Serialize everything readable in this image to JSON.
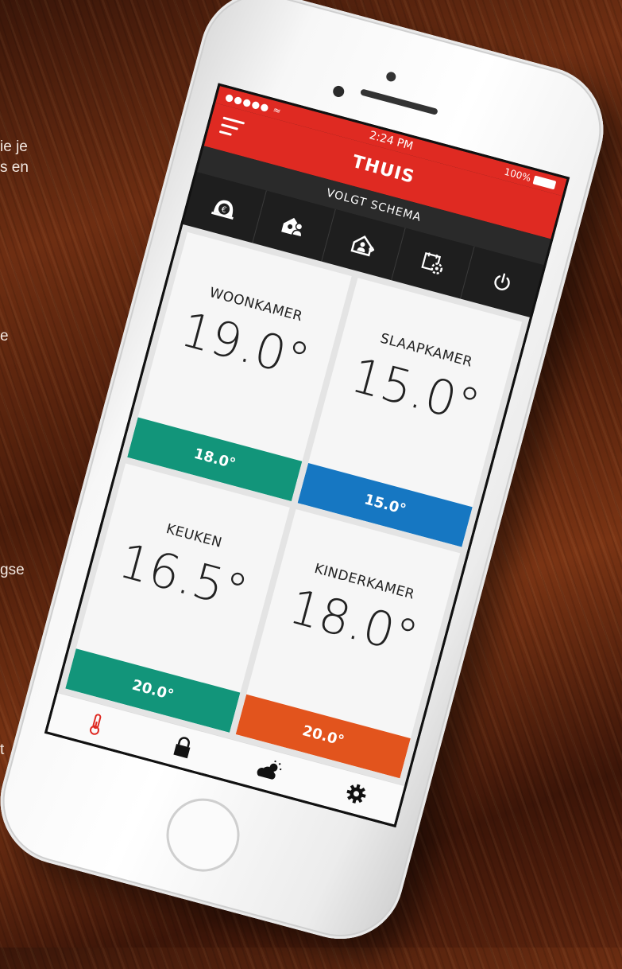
{
  "side_text": [
    "ie je",
    "s en",
    "e",
    "gse",
    "t"
  ],
  "status_bar": {
    "signal": "●●●●● ≈",
    "time": "2:24 PM",
    "battery": "100%"
  },
  "header": {
    "title": "THUIS",
    "mode": "VOLGT SCHEMA"
  },
  "icon_bar": [
    {
      "icon": "savings-euro-icon"
    },
    {
      "icon": "home-presence-icon"
    },
    {
      "icon": "home-away-icon"
    },
    {
      "icon": "schedule-settings-icon"
    },
    {
      "icon": "power-icon"
    }
  ],
  "rooms": [
    {
      "name": "WOONKAMER",
      "temp": "19.0°",
      "setpoint": "18.0°",
      "color": "#12957a"
    },
    {
      "name": "SLAAPKAMER",
      "temp": "15.0°",
      "setpoint": "15.0°",
      "color": "#1677c2"
    },
    {
      "name": "KEUKEN",
      "temp": "16.5°",
      "setpoint": "20.0°",
      "color": "#12957a"
    },
    {
      "name": "KINDERKAMER",
      "temp": "18.0°",
      "setpoint": "20.0°",
      "color": "#e2541d"
    }
  ],
  "tab_bar": [
    {
      "icon": "thermometer-icon",
      "active": true
    },
    {
      "icon": "lock-icon",
      "active": false
    },
    {
      "icon": "weather-icon",
      "active": false
    },
    {
      "icon": "gear-icon",
      "active": false
    }
  ],
  "colors": {
    "brand": "#df2a22",
    "dark": "#1e1e1e"
  }
}
